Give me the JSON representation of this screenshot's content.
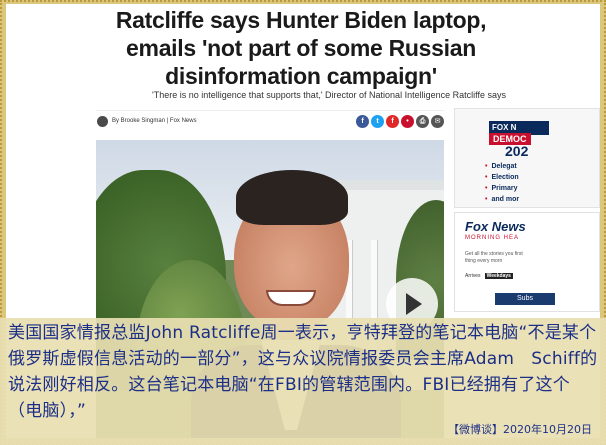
{
  "article": {
    "headline_line1": "Ratcliffe says Hunter Biden laptop,",
    "headline_line2": "emails 'not part of some Russian",
    "headline_line3": "disinformation campaign'",
    "subhead": "'There is no intelligence that supports that,' Director of National Intelligence Ratcliffe says",
    "byline": "By Brooke Singman | Fox News"
  },
  "share_icons": [
    {
      "name": "facebook-icon",
      "glyph": "f",
      "color": "#3b5998"
    },
    {
      "name": "twitter-icon",
      "glyph": "t",
      "color": "#1da1f2"
    },
    {
      "name": "flipboard-icon",
      "glyph": "f",
      "color": "#e12828"
    },
    {
      "name": "comments-icon",
      "glyph": "•",
      "color": "#c8102e"
    },
    {
      "name": "print-icon",
      "glyph": "⎙",
      "color": "#555555"
    },
    {
      "name": "email-icon",
      "glyph": "✉",
      "color": "#555555"
    }
  ],
  "sidebar": {
    "ad1_logo": "FOX N",
    "ad1_banner": "DEMOC",
    "ad1_year": "202",
    "ad1_items": [
      "Delegat",
      "Election",
      "Primary",
      "and mor"
    ],
    "ad2_logo": "Fox News",
    "ad2_sub": "MORNING HEA",
    "ad2_text": "Get all the stories you first thing every morn",
    "ad2_field_label": "Arrives",
    "ad2_field_value": "Weekdays",
    "ad2_button": "Subs"
  },
  "caption": {
    "text": "美国国家情报总监John Ratcliffe周一表示，亨特拜登的笔记本电脑“不是某个俄罗斯虚假信息活动的一部分”，这与众议院情报委员会主席Adam　Schiff的说法刚好相反。这台笔记本电脑“在FBI的管辖范围内。FBI已经拥有了这个（电脑），”",
    "source": "【微博谈】2020年10月20日"
  }
}
